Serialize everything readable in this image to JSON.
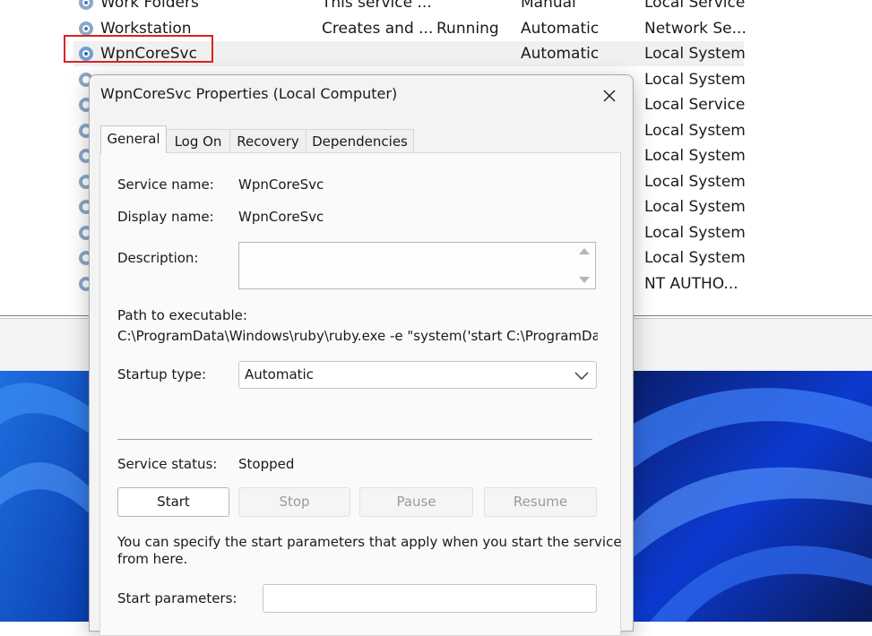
{
  "services": {
    "rows": [
      {
        "name": "Work Folders",
        "description": "This service ...",
        "status": "",
        "startup": "Manual",
        "logon": "Local Service"
      },
      {
        "name": "Workstation",
        "description": "Creates and ...",
        "status": "Running",
        "startup": "Automatic",
        "logon": "Network Se..."
      },
      {
        "name": "WpnCoreSvc",
        "description": "",
        "status": "",
        "startup": "Automatic",
        "logon": "Local System"
      },
      {
        "name": "",
        "description": "",
        "status": "",
        "startup": "",
        "logon": "Local System"
      },
      {
        "name": "",
        "description": "",
        "status": "",
        "startup": "",
        "logon": "Local Service"
      },
      {
        "name": "",
        "description": "",
        "status": "",
        "startup": "",
        "logon": "Local System"
      },
      {
        "name": "",
        "description": "",
        "status": "",
        "startup": "",
        "logon": "Local System"
      },
      {
        "name": "",
        "description": "",
        "status": "",
        "startup": "",
        "logon": "Local System"
      },
      {
        "name": "",
        "description": "",
        "status": "",
        "startup": "",
        "logon": "Local System"
      },
      {
        "name": "",
        "description": "",
        "status": "",
        "startup": "",
        "logon": "Local System"
      },
      {
        "name": "",
        "description": "",
        "status": "",
        "startup": "",
        "logon": "Local System"
      },
      {
        "name": "",
        "description": "",
        "status": "",
        "startup": "",
        "logon": "NT AUTHO..."
      }
    ],
    "highlight_color": "#d62424"
  },
  "dialog": {
    "title": "WpnCoreSvc Properties (Local Computer)",
    "tabs": [
      "General",
      "Log On",
      "Recovery",
      "Dependencies"
    ],
    "active_tab": "General",
    "service_name_label": "Service name:",
    "service_name": "WpnCoreSvc",
    "display_name_label": "Display name:",
    "display_name": "WpnCoreSvc",
    "description_label": "Description:",
    "path_label": "Path to executable:",
    "path_value": "C:\\ProgramData\\Windows\\ruby\\ruby.exe -e \"system('start C:\\ProgramData\\W",
    "startup_type_label": "Startup type:",
    "startup_type_value": "Automatic",
    "service_status_label": "Service status:",
    "service_status_value": "Stopped",
    "buttons": {
      "start": "Start",
      "stop": "Stop",
      "pause": "Pause",
      "resume": "Resume"
    },
    "hint_line1": "You can specify the start parameters that apply when you start the service",
    "hint_line2": "from here.",
    "start_params_label": "Start parameters:"
  }
}
